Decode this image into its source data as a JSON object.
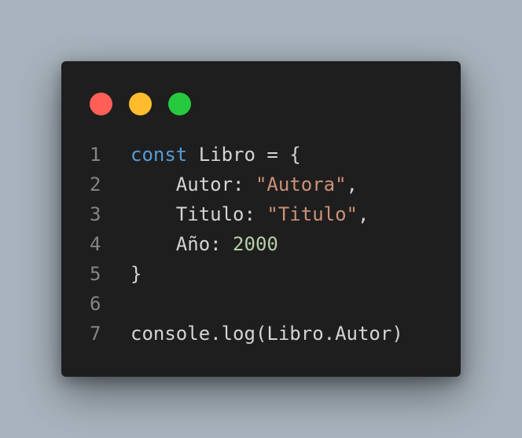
{
  "window": {
    "traffic_lights": [
      {
        "name": "close-dot",
        "color": "#ff5f56"
      },
      {
        "name": "minimize-dot",
        "color": "#ffbd2e"
      },
      {
        "name": "maximize-dot",
        "color": "#27c93f"
      }
    ]
  },
  "code": {
    "lines": [
      {
        "number": "1",
        "tokens": [
          {
            "type": "kw",
            "text": "const"
          },
          {
            "type": "plain",
            "text": " Libro = {"
          }
        ]
      },
      {
        "number": "2",
        "tokens": [
          {
            "type": "plain",
            "text": "    Autor: "
          },
          {
            "type": "str",
            "text": "\"Autora\""
          },
          {
            "type": "plain",
            "text": ","
          }
        ]
      },
      {
        "number": "3",
        "tokens": [
          {
            "type": "plain",
            "text": "    Titulo: "
          },
          {
            "type": "str",
            "text": "\"Titulo\""
          },
          {
            "type": "plain",
            "text": ","
          }
        ]
      },
      {
        "number": "4",
        "tokens": [
          {
            "type": "plain",
            "text": "    Año: "
          },
          {
            "type": "num",
            "text": "2000"
          }
        ]
      },
      {
        "number": "5",
        "tokens": [
          {
            "type": "plain",
            "text": "}"
          }
        ]
      },
      {
        "number": "6",
        "tokens": []
      },
      {
        "number": "7",
        "tokens": [
          {
            "type": "plain",
            "text": "console.log(Libro.Autor)"
          }
        ]
      }
    ]
  }
}
